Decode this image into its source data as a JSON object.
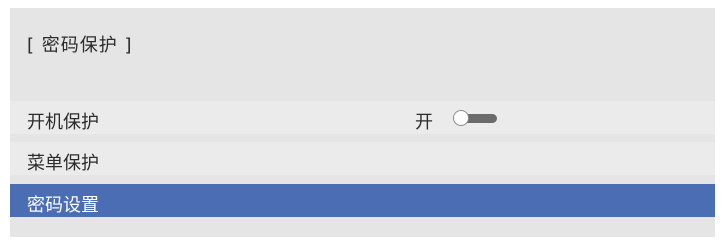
{
  "header": {
    "title": "[ 密码保护 ]"
  },
  "menu": {
    "items": [
      {
        "label": "开机保护",
        "value": "开",
        "toggle_on": false
      },
      {
        "label": "菜单保护"
      },
      {
        "label": "密码设置",
        "selected": true
      }
    ]
  },
  "colors": {
    "panel_bg": "#e5e5e5",
    "row_bg": "#ebebeb",
    "selected_bg": "#4a6db4",
    "toggle_track": "#6b6b6b"
  },
  "icons": {
    "toggle": "toggle-switch-icon"
  }
}
